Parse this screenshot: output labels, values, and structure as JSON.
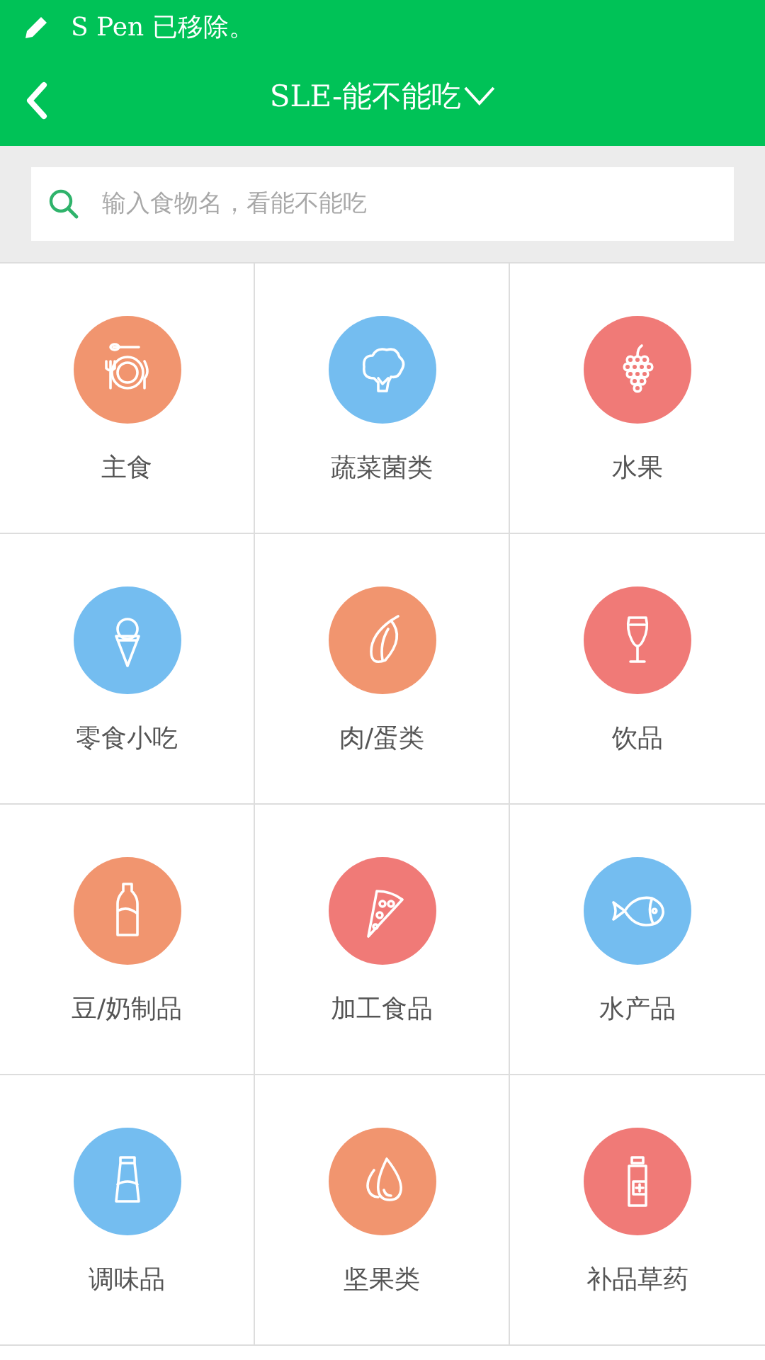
{
  "notification": {
    "text": "S Pen 已移除。"
  },
  "header": {
    "title": "SLE-能不能吃"
  },
  "search": {
    "placeholder": "输入食物名，看能不能吃"
  },
  "categories": [
    {
      "label": "主食",
      "color": "#f1956f"
    },
    {
      "label": "蔬菜菌类",
      "color": "#74bdf0"
    },
    {
      "label": "水果",
      "color": "#f07a77"
    },
    {
      "label": "零食小吃",
      "color": "#74bdf0"
    },
    {
      "label": "肉/蛋类",
      "color": "#f1956f"
    },
    {
      "label": "饮品",
      "color": "#f07a77"
    },
    {
      "label": "豆/奶制品",
      "color": "#f1956f"
    },
    {
      "label": "加工食品",
      "color": "#f07a77"
    },
    {
      "label": "水产品",
      "color": "#74bdf0"
    },
    {
      "label": "调味品",
      "color": "#74bdf0"
    },
    {
      "label": "坚果类",
      "color": "#f1956f"
    },
    {
      "label": "补品草药",
      "color": "#f07a77"
    }
  ]
}
